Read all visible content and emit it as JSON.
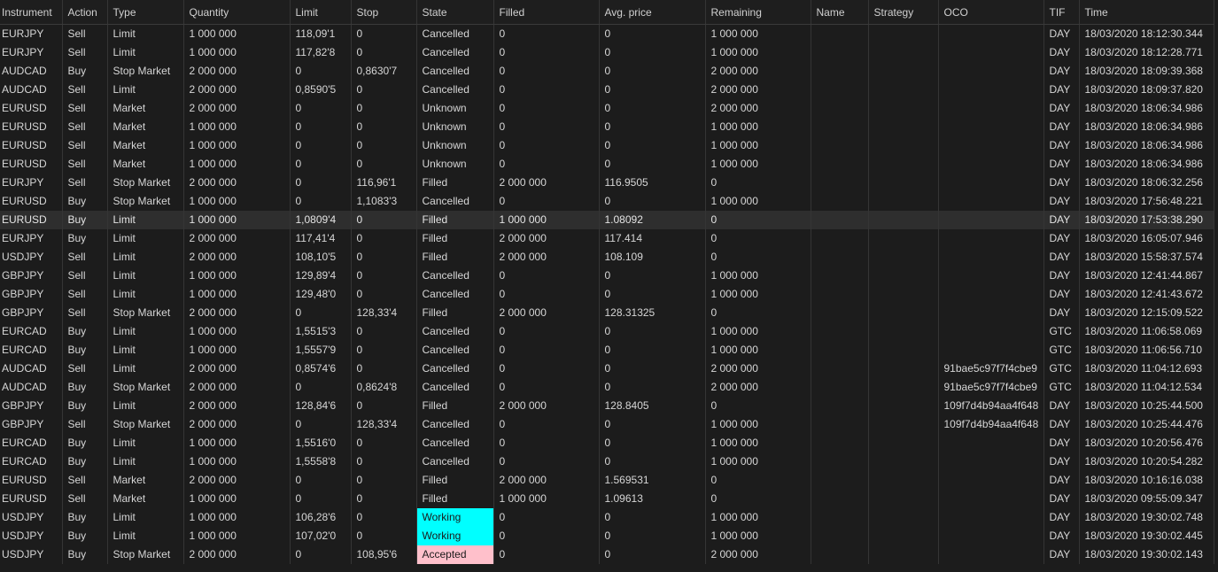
{
  "columns": [
    "Instrument",
    "Action",
    "Type",
    "Quantity",
    "Limit",
    "Stop",
    "State",
    "Filled",
    "Avg. price",
    "Remaining",
    "Name",
    "Strategy",
    "OCO",
    "TIF",
    "Time"
  ],
  "selected_row": 10,
  "state_colors": {
    "Working": "#00ffff",
    "Accepted": "#ffc0cb"
  },
  "rows": [
    [
      "EURJPY",
      "Sell",
      "Limit",
      "1 000 000",
      "118,09'1",
      "0",
      "Cancelled",
      "0",
      "0",
      "1 000 000",
      "",
      "",
      "",
      "DAY",
      "18/03/2020 18:12:30.344"
    ],
    [
      "EURJPY",
      "Sell",
      "Limit",
      "1 000 000",
      "117,82'8",
      "0",
      "Cancelled",
      "0",
      "0",
      "1 000 000",
      "",
      "",
      "",
      "DAY",
      "18/03/2020 18:12:28.771"
    ],
    [
      "AUDCAD",
      "Buy",
      "Stop Market",
      "2 000 000",
      "0",
      "0,8630'7",
      "Cancelled",
      "0",
      "0",
      "2 000 000",
      "",
      "",
      "",
      "DAY",
      "18/03/2020 18:09:39.368"
    ],
    [
      "AUDCAD",
      "Sell",
      "Limit",
      "2 000 000",
      "0,8590'5",
      "0",
      "Cancelled",
      "0",
      "0",
      "2 000 000",
      "",
      "",
      "",
      "DAY",
      "18/03/2020 18:09:37.820"
    ],
    [
      "EURUSD",
      "Sell",
      "Market",
      "2 000 000",
      "0",
      "0",
      "Unknown",
      "0",
      "0",
      "2 000 000",
      "",
      "",
      "",
      "DAY",
      "18/03/2020 18:06:34.986"
    ],
    [
      "EURUSD",
      "Sell",
      "Market",
      "1 000 000",
      "0",
      "0",
      "Unknown",
      "0",
      "0",
      "1 000 000",
      "",
      "",
      "",
      "DAY",
      "18/03/2020 18:06:34.986"
    ],
    [
      "EURUSD",
      "Sell",
      "Market",
      "1 000 000",
      "0",
      "0",
      "Unknown",
      "0",
      "0",
      "1 000 000",
      "",
      "",
      "",
      "DAY",
      "18/03/2020 18:06:34.986"
    ],
    [
      "EURUSD",
      "Sell",
      "Market",
      "1 000 000",
      "0",
      "0",
      "Unknown",
      "0",
      "0",
      "1 000 000",
      "",
      "",
      "",
      "DAY",
      "18/03/2020 18:06:34.986"
    ],
    [
      "EURJPY",
      "Sell",
      "Stop Market",
      "2 000 000",
      "0",
      "116,96'1",
      "Filled",
      "2 000 000",
      "116.9505",
      "0",
      "",
      "",
      "",
      "DAY",
      "18/03/2020 18:06:32.256"
    ],
    [
      "EURUSD",
      "Buy",
      "Stop Market",
      "1 000 000",
      "0",
      "1,1083'3",
      "Cancelled",
      "0",
      "0",
      "1 000 000",
      "",
      "",
      "",
      "DAY",
      "18/03/2020 17:56:48.221"
    ],
    [
      "EURUSD",
      "Buy",
      "Limit",
      "1 000 000",
      "1,0809'4",
      "0",
      "Filled",
      "1 000 000",
      "1.08092",
      "0",
      "",
      "",
      "",
      "DAY",
      "18/03/2020 17:53:38.290"
    ],
    [
      "EURJPY",
      "Buy",
      "Limit",
      "2 000 000",
      "117,41'4",
      "0",
      "Filled",
      "2 000 000",
      "117.414",
      "0",
      "",
      "",
      "",
      "DAY",
      "18/03/2020 16:05:07.946"
    ],
    [
      "USDJPY",
      "Sell",
      "Limit",
      "2 000 000",
      "108,10'5",
      "0",
      "Filled",
      "2 000 000",
      "108.109",
      "0",
      "",
      "",
      "",
      "DAY",
      "18/03/2020 15:58:37.574"
    ],
    [
      "GBPJPY",
      "Sell",
      "Limit",
      "1 000 000",
      "129,89'4",
      "0",
      "Cancelled",
      "0",
      "0",
      "1 000 000",
      "",
      "",
      "",
      "DAY",
      "18/03/2020 12:41:44.867"
    ],
    [
      "GBPJPY",
      "Sell",
      "Limit",
      "1 000 000",
      "129,48'0",
      "0",
      "Cancelled",
      "0",
      "0",
      "1 000 000",
      "",
      "",
      "",
      "DAY",
      "18/03/2020 12:41:43.672"
    ],
    [
      "GBPJPY",
      "Sell",
      "Stop Market",
      "2 000 000",
      "0",
      "128,33'4",
      "Filled",
      "2 000 000",
      "128.31325",
      "0",
      "",
      "",
      "",
      "DAY",
      "18/03/2020 12:15:09.522"
    ],
    [
      "EURCAD",
      "Buy",
      "Limit",
      "1 000 000",
      "1,5515'3",
      "0",
      "Cancelled",
      "0",
      "0",
      "1 000 000",
      "",
      "",
      "",
      "GTC",
      "18/03/2020 11:06:58.069"
    ],
    [
      "EURCAD",
      "Buy",
      "Limit",
      "1 000 000",
      "1,5557'9",
      "0",
      "Cancelled",
      "0",
      "0",
      "1 000 000",
      "",
      "",
      "",
      "GTC",
      "18/03/2020 11:06:56.710"
    ],
    [
      "AUDCAD",
      "Sell",
      "Limit",
      "2 000 000",
      "0,8574'6",
      "0",
      "Cancelled",
      "0",
      "0",
      "2 000 000",
      "",
      "",
      "91bae5c97f7f4cbe9",
      "GTC",
      "18/03/2020 11:04:12.693"
    ],
    [
      "AUDCAD",
      "Buy",
      "Stop Market",
      "2 000 000",
      "0",
      "0,8624'8",
      "Cancelled",
      "0",
      "0",
      "2 000 000",
      "",
      "",
      "91bae5c97f7f4cbe9",
      "GTC",
      "18/03/2020 11:04:12.534"
    ],
    [
      "GBPJPY",
      "Buy",
      "Limit",
      "2 000 000",
      "128,84'6",
      "0",
      "Filled",
      "2 000 000",
      "128.8405",
      "0",
      "",
      "",
      "109f7d4b94aa4f648",
      "DAY",
      "18/03/2020 10:25:44.500"
    ],
    [
      "GBPJPY",
      "Sell",
      "Stop Market",
      "2 000 000",
      "0",
      "128,33'4",
      "Cancelled",
      "0",
      "0",
      "1 000 000",
      "",
      "",
      "109f7d4b94aa4f648",
      "DAY",
      "18/03/2020 10:25:44.476"
    ],
    [
      "EURCAD",
      "Buy",
      "Limit",
      "1 000 000",
      "1,5516'0",
      "0",
      "Cancelled",
      "0",
      "0",
      "1 000 000",
      "",
      "",
      "",
      "DAY",
      "18/03/2020 10:20:56.476"
    ],
    [
      "EURCAD",
      "Buy",
      "Limit",
      "1 000 000",
      "1,5558'8",
      "0",
      "Cancelled",
      "0",
      "0",
      "1 000 000",
      "",
      "",
      "",
      "DAY",
      "18/03/2020 10:20:54.282"
    ],
    [
      "EURUSD",
      "Sell",
      "Market",
      "2 000 000",
      "0",
      "0",
      "Filled",
      "2 000 000",
      "1.569531",
      "0",
      "",
      "",
      "",
      "DAY",
      "18/03/2020 10:16:16.038"
    ],
    [
      "EURUSD",
      "Sell",
      "Market",
      "1 000 000",
      "0",
      "0",
      "Filled",
      "1 000 000",
      "1.09613",
      "0",
      "",
      "",
      "",
      "DAY",
      "18/03/2020 09:55:09.347"
    ],
    [
      "USDJPY",
      "Buy",
      "Limit",
      "1 000 000",
      "106,28'6",
      "0",
      "Working",
      "0",
      "0",
      "1 000 000",
      "",
      "",
      "",
      "DAY",
      "18/03/2020 19:30:02.748"
    ],
    [
      "USDJPY",
      "Buy",
      "Limit",
      "1 000 000",
      "107,02'0",
      "0",
      "Working",
      "0",
      "0",
      "1 000 000",
      "",
      "",
      "",
      "DAY",
      "18/03/2020 19:30:02.445"
    ],
    [
      "USDJPY",
      "Buy",
      "Stop Market",
      "2 000 000",
      "0",
      "108,95'6",
      "Accepted",
      "0",
      "0",
      "2 000 000",
      "",
      "",
      "",
      "DAY",
      "18/03/2020 19:30:02.143"
    ]
  ]
}
